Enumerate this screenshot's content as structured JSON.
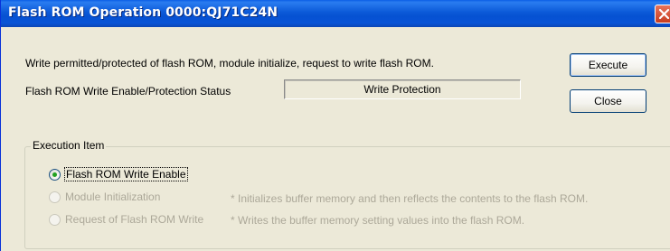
{
  "window": {
    "title": "Flash ROM Operation 0000:QJ71C24N"
  },
  "description": "Write permitted/protected of flash ROM, module initialize, request to write flash ROM.",
  "status": {
    "label": "Flash ROM Write Enable/Protection Status",
    "value": "Write Protection"
  },
  "buttons": {
    "execute": "Execute",
    "close": "Close"
  },
  "execution_item": {
    "caption": "Execution Item",
    "options": [
      {
        "label": "Flash ROM Write Enable",
        "selected": true,
        "enabled": true,
        "note": ""
      },
      {
        "label": "Module Initialization",
        "selected": false,
        "enabled": false,
        "note": "* Initializes buffer memory and then reflects the contents to the flash ROM."
      },
      {
        "label": "Request of Flash ROM Write",
        "selected": false,
        "enabled": false,
        "note": "* Writes the buffer memory setting values into the flash ROM."
      }
    ]
  },
  "colors": {
    "titlebar": "#0054e3",
    "dialog_background": "#ece9d8",
    "disabled_text": "#aca899",
    "radio_selected_dot": "#21a121"
  }
}
